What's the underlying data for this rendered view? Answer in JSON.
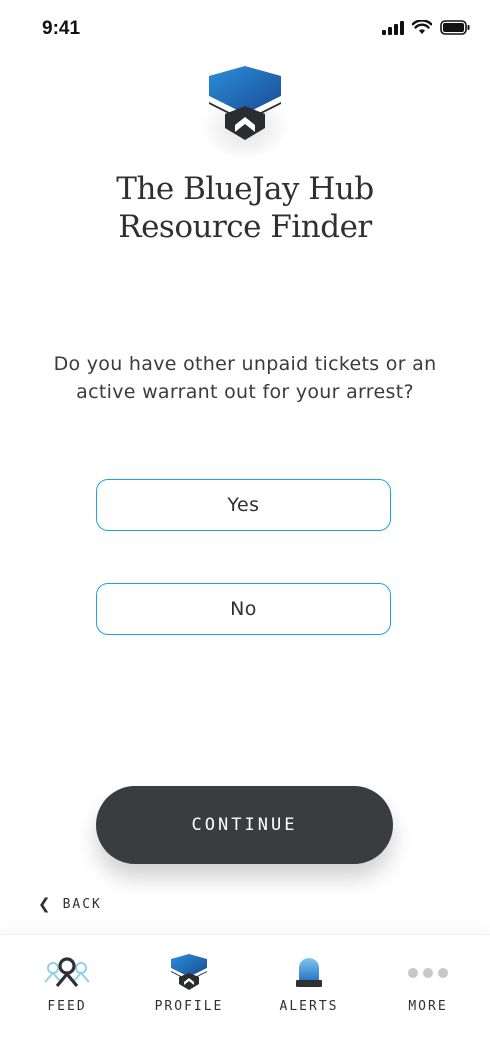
{
  "status_bar": {
    "time": "9:41"
  },
  "header": {
    "title_line1": "The BlueJay Hub",
    "title_line2": "Resource Finder"
  },
  "question": {
    "text": "Do you have other unpaid tickets or an active warrant out for your arrest?"
  },
  "options": [
    {
      "label": "Yes"
    },
    {
      "label": "No"
    }
  ],
  "actions": {
    "continue_label": "CONTINUE",
    "back_label": "BACK"
  },
  "tabbar": {
    "items": [
      {
        "label": "FEED",
        "icon": "feed-people-icon"
      },
      {
        "label": "PROFILE",
        "icon": "bluejay-shield-icon"
      },
      {
        "label": "ALERTS",
        "icon": "siren-icon"
      },
      {
        "label": "MORE",
        "icon": "more-dots-icon"
      }
    ]
  },
  "colors": {
    "accent": "#1fa3dd",
    "dark": "#3b3c40",
    "text": "#2f3034"
  }
}
